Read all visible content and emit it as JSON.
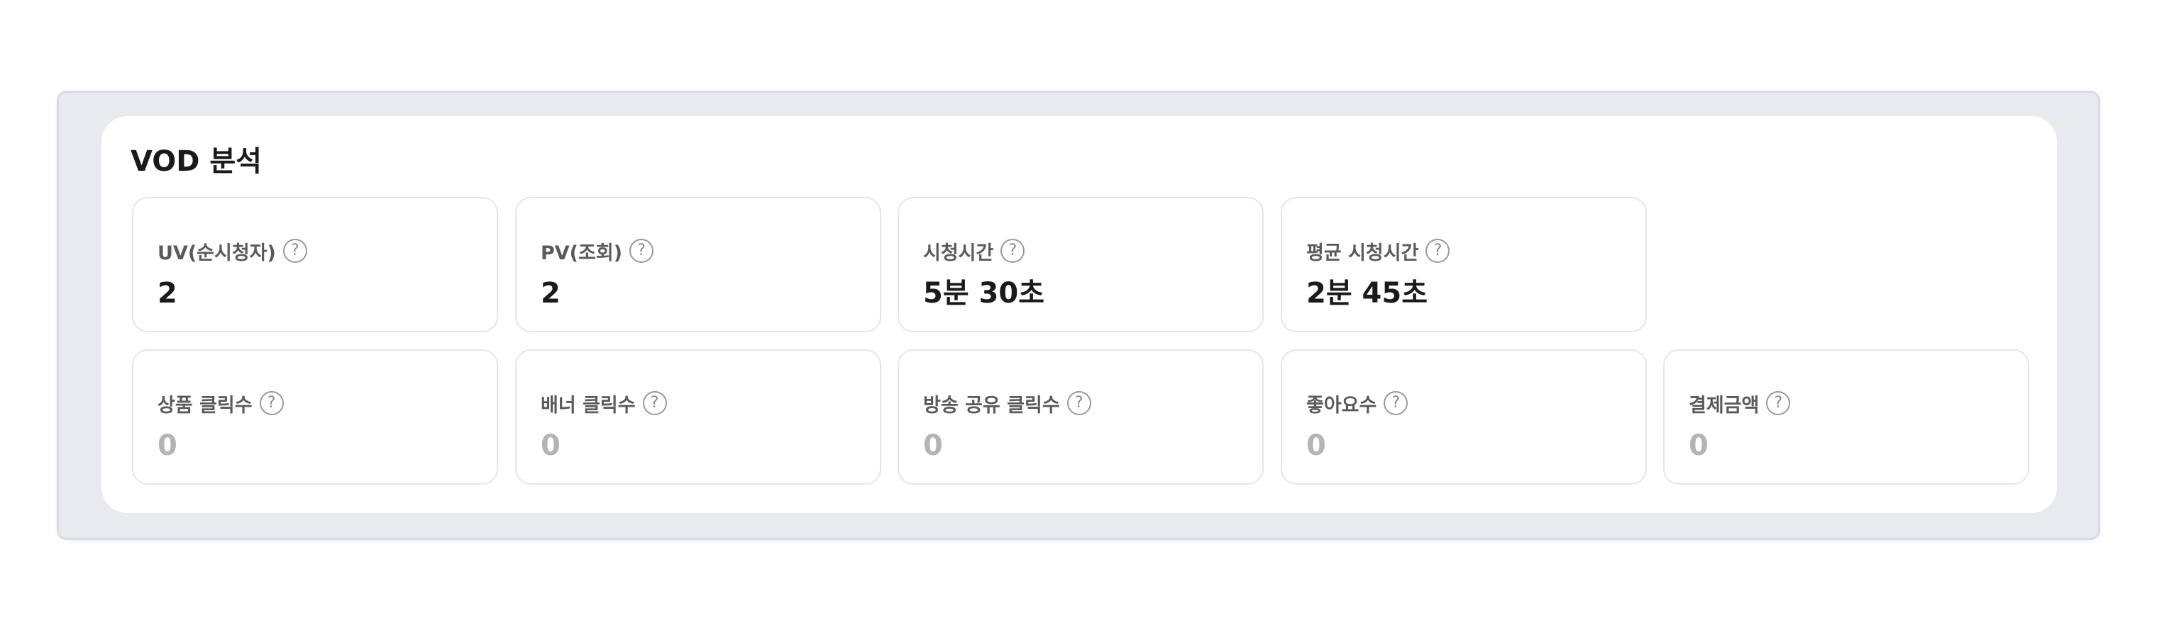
{
  "title": "VOD 분석",
  "top_metrics": [
    {
      "label": "UV(순시청자)",
      "value": "2"
    },
    {
      "label": "PV(조회)",
      "value": "2"
    },
    {
      "label": "시청시간",
      "value": "5분 30초"
    },
    {
      "label": "평균 시청시간",
      "value": "2분 45초"
    }
  ],
  "bottom_metrics": [
    {
      "label": "상품 클릭수",
      "value": "0"
    },
    {
      "label": "배너 클릭수",
      "value": "0"
    },
    {
      "label": "방송 공유 클릭수",
      "value": "0"
    },
    {
      "label": "좋아요수",
      "value": "0"
    },
    {
      "label": "결제금액",
      "value": "0"
    }
  ],
  "icons": {
    "help": "question-circle-icon"
  },
  "colors": {
    "outer_background": "#e9eaee",
    "panel_background": "#ffffff",
    "value_active": "#1a1a1a",
    "value_zero": "#b4b4b4"
  }
}
